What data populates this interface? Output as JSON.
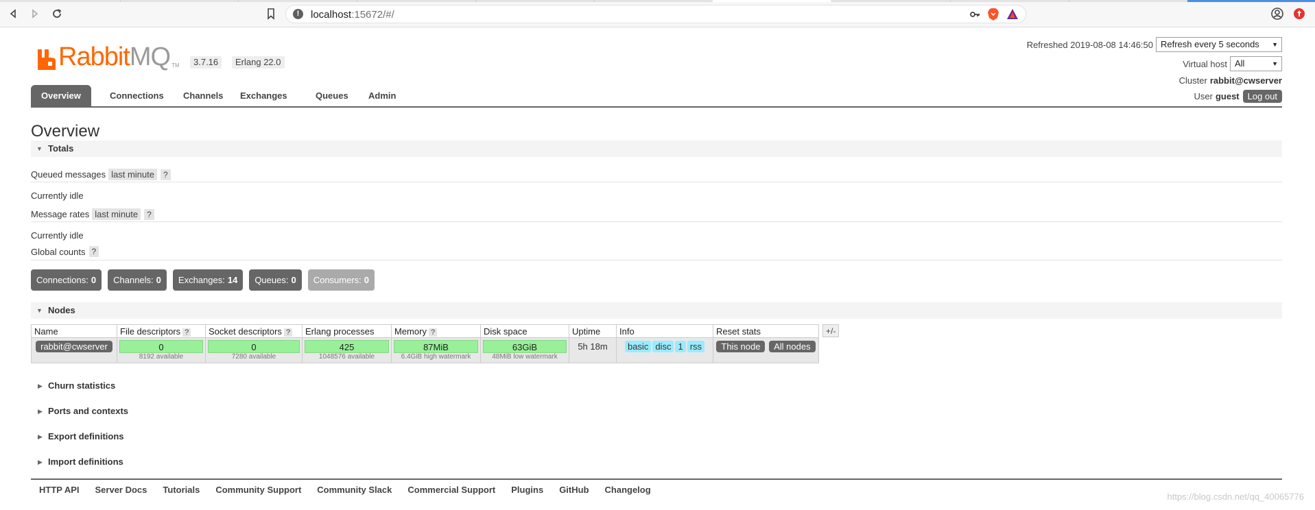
{
  "browser": {
    "url_host": "localhost",
    "url_rest": ":15672/#/"
  },
  "app": {
    "logo_rabbit": "Rabbit",
    "logo_mq": "MQ",
    "logo_tm": "TM",
    "version": "3.7.16",
    "erlang": "Erlang 22.0",
    "brand_color": "#ff6600"
  },
  "header": {
    "refreshed_label": "Refreshed 2019-08-08 14:46:50",
    "refresh_option": "Refresh every 5 seconds",
    "vhost_label": "Virtual host",
    "vhost_value": "All",
    "cluster_label": "Cluster",
    "cluster_value": "rabbit@cwserver",
    "user_label": "User",
    "user_value": "guest",
    "logout": "Log out"
  },
  "tabs": [
    "Overview",
    "Connections",
    "Channels",
    "Exchanges",
    "Queues",
    "Admin"
  ],
  "main": {
    "title": "Overview",
    "totals": "Totals",
    "queued_messages": "Queued messages",
    "last_minute_1": "last minute",
    "help": "?",
    "currently_idle_1": "Currently idle",
    "message_rates": "Message rates",
    "last_minute_2": "last minute",
    "currently_idle_2": "Currently idle",
    "global_counts": "Global counts"
  },
  "counts": [
    {
      "label": "Connections:",
      "value": "0"
    },
    {
      "label": "Channels:",
      "value": "0"
    },
    {
      "label": "Exchanges:",
      "value": "14"
    },
    {
      "label": "Queues:",
      "value": "0"
    },
    {
      "label": "Consumers:",
      "value": "0"
    }
  ],
  "nodes": {
    "title": "Nodes",
    "plusminus": "+/-",
    "headers": [
      "Name",
      "File descriptors",
      "Socket descriptors",
      "Erlang processes",
      "Memory",
      "Disk space",
      "Uptime",
      "Info",
      "Reset stats"
    ],
    "row": {
      "name": "rabbit@cwserver",
      "fd": "0",
      "fd_sub": "8192 available",
      "sd": "0",
      "sd_sub": "7280 available",
      "ep": "425",
      "ep_sub": "1048576 available",
      "mem": "87MiB",
      "mem_sub": "6.4GiB high watermark",
      "disk": "63GiB",
      "disk_sub": "48MiB low watermark",
      "uptime": "5h 18m",
      "info": [
        "basic",
        "disc",
        "1",
        "rss"
      ],
      "reset_this": "This node",
      "reset_all": "All nodes"
    }
  },
  "collapsed_sections": [
    "Churn statistics",
    "Ports and contexts",
    "Export definitions",
    "Import definitions"
  ],
  "footer": [
    "HTTP API",
    "Server Docs",
    "Tutorials",
    "Community Support",
    "Community Slack",
    "Commercial Support",
    "Plugins",
    "GitHub",
    "Changelog"
  ],
  "watermark": "https://blog.csdn.net/qq_40065776",
  "icons": [
    "back-icon",
    "forward-icon",
    "reload-icon",
    "bookmark-icon",
    "info-icon",
    "key-icon",
    "brave-icon",
    "bat-icon",
    "profile-icon",
    "notification-icon",
    "rabbitmq-logo-icon"
  ]
}
